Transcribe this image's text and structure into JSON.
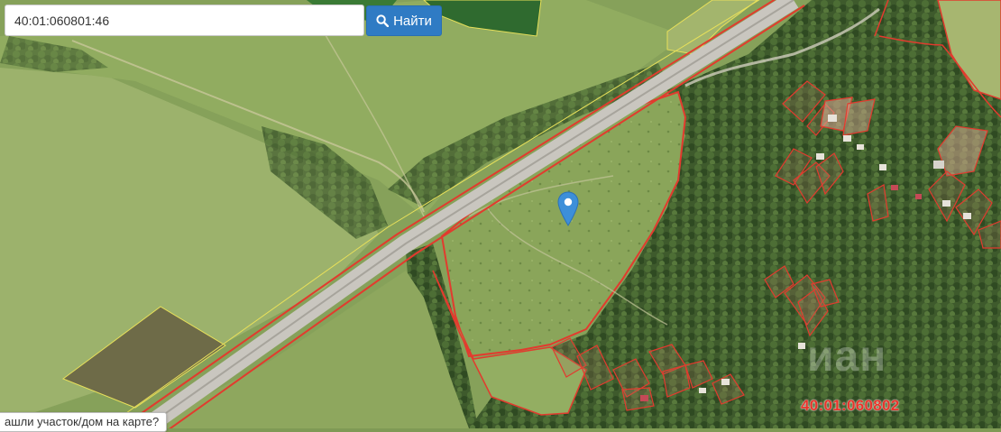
{
  "search": {
    "value": "40:01:060801:46",
    "button_label": "Найти",
    "button_icon": "search-icon"
  },
  "map": {
    "cadastral_label": "40:01:060802",
    "watermark": "иан",
    "hint": "ашли участок/дом на карте?",
    "colors": {
      "boundary": "#e23b2e",
      "parcel_yellow": "#e8e05a",
      "accent": "#2f7bc4",
      "marker": "#3d8fd9"
    }
  }
}
